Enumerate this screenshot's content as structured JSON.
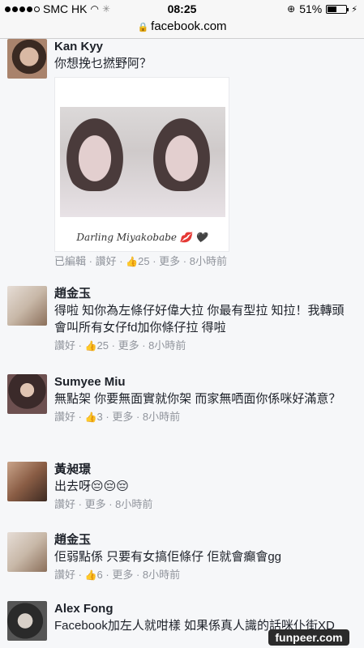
{
  "status_bar": {
    "carrier": "SMC HK",
    "time": "08:25",
    "battery": "51%",
    "battery_level": 0.51
  },
  "browser": {
    "url": "facebook.com"
  },
  "comments": [
    {
      "author": "Kan Kyy",
      "text": "你想挽乜撚野阿？",
      "photo_caption": "Darling Miyakobabe",
      "meta": {
        "edited": "已編輯",
        "like": "讚好",
        "likes": "25",
        "more": "更多",
        "time": "8小時前"
      }
    },
    {
      "author": "趙金玉",
      "text": "得啦 知你為左條仔好偉大拉 你最有型拉 知拉！我轉頭會叫所有女仔fd加你條仔拉 得啦",
      "meta": {
        "like": "讚好",
        "likes": "25",
        "more": "更多",
        "time": "8小時前"
      }
    },
    {
      "author": "Sumyee Miu",
      "text": "無點架 你要無面實就你架 而家無哂面你係咪好滿意？",
      "meta": {
        "like": "讚好",
        "likes": "3",
        "more": "更多",
        "time": "8小時前"
      }
    },
    {
      "author": "黃昶璟",
      "text": "出去呀😔😔😔",
      "meta": {
        "like": "讚好",
        "more": "更多",
        "time": "8小時前"
      }
    },
    {
      "author": "趙金玉",
      "text": "佢弱點係 只要有女搞佢條仔 佢就會癲會gg",
      "meta": {
        "like": "讚好",
        "likes": "6",
        "more": "更多",
        "time": "8小時前"
      }
    },
    {
      "author": "Alex Fong",
      "text": "Facebook加左人就咁樣 如果係真人識的話咪仆街XD"
    }
  ],
  "watermark": "funpeer.com"
}
